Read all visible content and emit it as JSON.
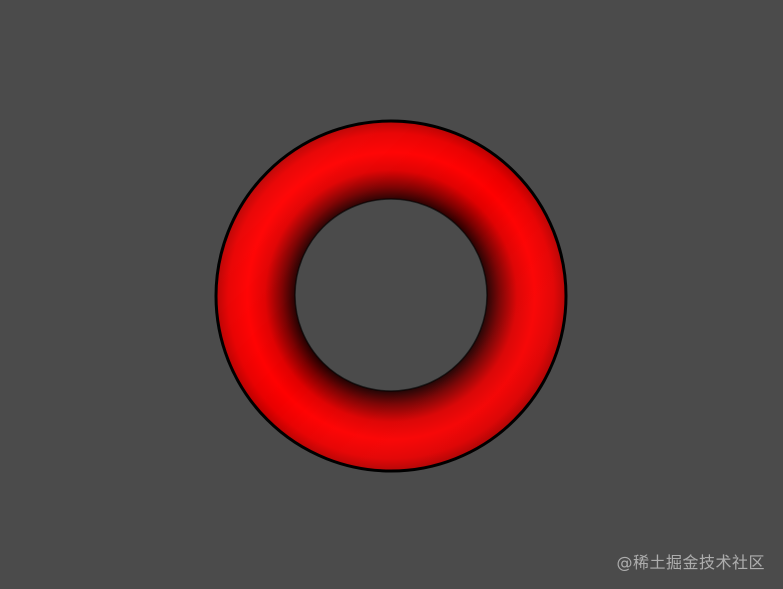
{
  "scene": {
    "background_color": "#4b4b4b",
    "object": "torus",
    "object_color": "#ff0000",
    "shadow_color": "#1a0000",
    "outline_color": "#000000"
  },
  "watermark": {
    "text": "@稀土掘金技术社区"
  }
}
